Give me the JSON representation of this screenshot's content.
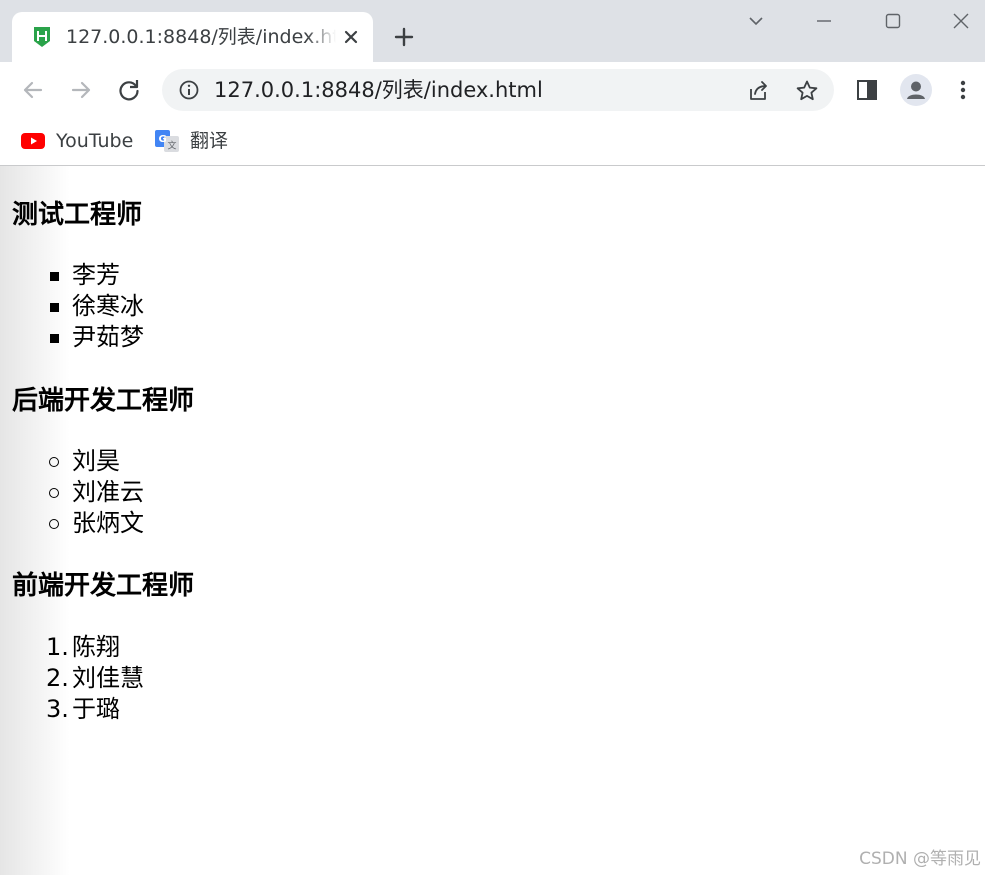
{
  "browser": {
    "tab": {
      "title": "127.0.0.1:8848/列表/index.html"
    },
    "url": "127.0.0.1:8848/列表/index.html",
    "bookmarks": [
      {
        "label": "YouTube",
        "icon": "youtube-icon"
      },
      {
        "label": "翻译",
        "icon": "google-translate-icon"
      }
    ],
    "colors": {
      "tabstrip": "#dee1e6",
      "omnibox": "#f1f3f4",
      "favicon": "#2aa34a",
      "youtube": "#ff0000"
    }
  },
  "page": {
    "sections": [
      {
        "heading": "测试工程师",
        "list_type": "square",
        "items": [
          "李芳",
          "徐寒冰",
          "尹茹梦"
        ]
      },
      {
        "heading": "后端开发工程师",
        "list_type": "circle",
        "items": [
          "刘昊",
          "刘准云",
          "张炳文"
        ]
      },
      {
        "heading": "前端开发工程师",
        "list_type": "decimal",
        "items": [
          "陈翔",
          "刘佳慧",
          "于璐"
        ],
        "markers": [
          "1.",
          "2.",
          "3."
        ]
      }
    ],
    "watermark": "CSDN @等雨见"
  }
}
